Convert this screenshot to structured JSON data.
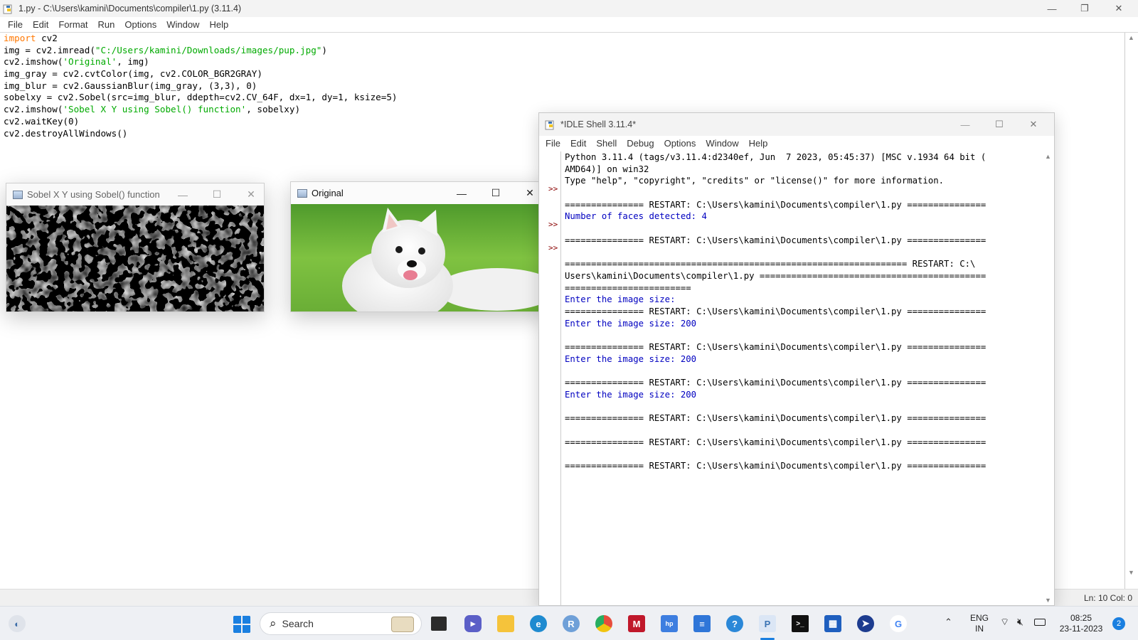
{
  "editor": {
    "title": "1.py - C:\\Users\\kamini\\Documents\\compiler\\1.py (3.11.4)",
    "menu": [
      "File",
      "Edit",
      "Format",
      "Run",
      "Options",
      "Window",
      "Help"
    ],
    "status": "Ln: 10   Col: 0"
  },
  "code": {
    "l1_kw": "import",
    "l1_rest": " cv2",
    "l2_a": "img = cv2.imread(",
    "l2_s": "\"C:/Users/kamini/Downloads/images/pup.jpg\"",
    "l2_b": ")",
    "l3_a": "cv2.imshow(",
    "l3_s": "'Original'",
    "l3_b": ", img)",
    "l4": "img_gray = cv2.cvtColor(img, cv2.COLOR_BGR2GRAY)",
    "l5": "img_blur = cv2.GaussianBlur(img_gray, (3,3), 0)",
    "l6": "sobelxy = cv2.Sobel(src=img_blur, ddepth=cv2.CV_64F, dx=1, dy=1, ksize=5)",
    "l7_a": "cv2.imshow(",
    "l7_s": "'Sobel X Y using Sobel() function'",
    "l7_b": ", sobelxy)",
    "l8": "cv2.waitKey(0)",
    "l9": "cv2.destroyAllWindows()"
  },
  "sobel_window": {
    "title": "Sobel X Y using Sobel() function"
  },
  "original_window": {
    "title": "Original"
  },
  "shell": {
    "title": "*IDLE Shell 3.11.4*",
    "menu": [
      "File",
      "Edit",
      "Shell",
      "Debug",
      "Options",
      "Window",
      "Help"
    ],
    "prompt": ">>",
    "lines": [
      {
        "t": "Python 3.11.4 (tags/v3.11.4:d2340ef, Jun  7 2023, 05:45:37) [MSC v.1934 64 bit (",
        "c": ""
      },
      {
        "t": "AMD64)] on win32",
        "c": ""
      },
      {
        "t": "Type \"help\", \"copyright\", \"credits\" or \"license()\" for more information.",
        "c": ""
      },
      {
        "t": "",
        "c": ""
      },
      {
        "t": "=============== RESTART: C:\\Users\\kamini\\Documents\\compiler\\1.py ===============",
        "c": ""
      },
      {
        "t": "Number of faces detected: 4",
        "c": "blue"
      },
      {
        "t": "",
        "c": ""
      },
      {
        "t": "=============== RESTART: C:\\Users\\kamini\\Documents\\compiler\\1.py ===============",
        "c": ""
      },
      {
        "t": "",
        "c": ""
      },
      {
        "t": "================================================================= RESTART: C:\\",
        "c": ""
      },
      {
        "t": "Users\\kamini\\Documents\\compiler\\1.py ===========================================",
        "c": ""
      },
      {
        "t": "========================",
        "c": ""
      },
      {
        "t": "Enter the image size:",
        "c": "blue"
      },
      {
        "t": "=============== RESTART: C:\\Users\\kamini\\Documents\\compiler\\1.py ===============",
        "c": ""
      },
      {
        "t": "Enter the image size: 200",
        "c": "blue"
      },
      {
        "t": "",
        "c": ""
      },
      {
        "t": "=============== RESTART: C:\\Users\\kamini\\Documents\\compiler\\1.py ===============",
        "c": ""
      },
      {
        "t": "Enter the image size: 200",
        "c": "blue"
      },
      {
        "t": "",
        "c": ""
      },
      {
        "t": "=============== RESTART: C:\\Users\\kamini\\Documents\\compiler\\1.py ===============",
        "c": ""
      },
      {
        "t": "Enter the image size: 200",
        "c": "blue"
      },
      {
        "t": "",
        "c": ""
      },
      {
        "t": "=============== RESTART: C:\\Users\\kamini\\Documents\\compiler\\1.py ===============",
        "c": ""
      },
      {
        "t": "",
        "c": ""
      },
      {
        "t": "=============== RESTART: C:\\Users\\kamini\\Documents\\compiler\\1.py ===============",
        "c": ""
      },
      {
        "t": "",
        "c": ""
      },
      {
        "t": "=============== RESTART: C:\\Users\\kamini\\Documents\\compiler\\1.py ===============",
        "c": ""
      }
    ]
  },
  "taskbar": {
    "search_label": "Search",
    "lang_top": "ENG",
    "lang_bottom": "IN",
    "time": "08:25",
    "date": "23-11-2023",
    "notifications": "2"
  }
}
